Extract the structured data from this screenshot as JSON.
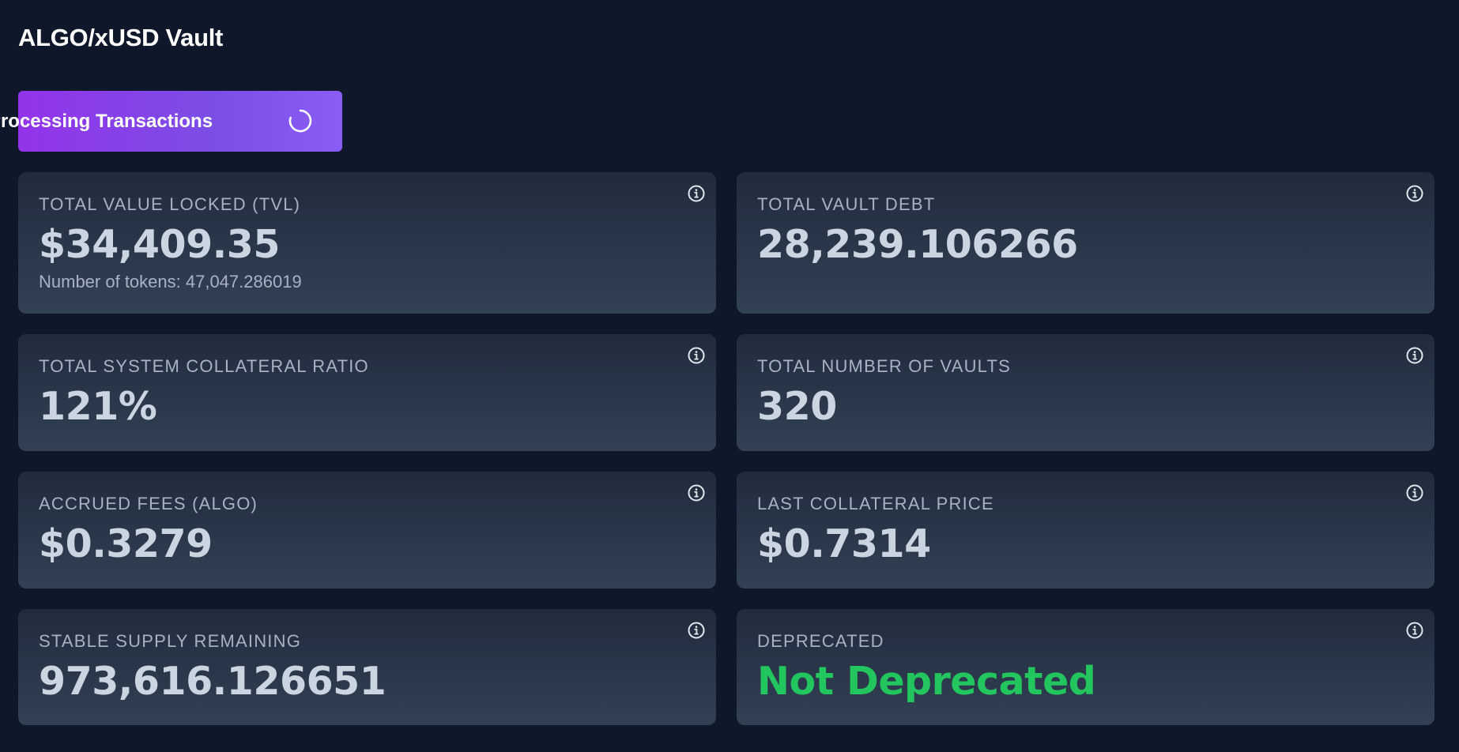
{
  "header": {
    "title": "ALGO/xUSD Vault"
  },
  "status_button": {
    "label": "Processing Transactions",
    "icon": "spinner-icon"
  },
  "colors": {
    "background": "#0f172a",
    "button": "#9333ea",
    "card_top": "#202b3d",
    "card_bottom": "#334155",
    "value_text": "#cbd5e1",
    "label_text": "#a7b3c4",
    "positive": "#22c55e"
  },
  "stats": {
    "tvl": {
      "label": "TOTAL VALUE LOCKED (TVL)",
      "value": "$34,409.35",
      "sub": "Number of tokens: 47,047.286019",
      "icon": "info-icon"
    },
    "vault_debt": {
      "label": "TOTAL VAULT DEBT",
      "value": "28,239.106266",
      "icon": "info-icon"
    },
    "collateral_ratio": {
      "label": "TOTAL SYSTEM COLLATERAL RATIO",
      "value": "121%",
      "icon": "info-icon"
    },
    "num_vaults": {
      "label": "TOTAL NUMBER OF VAULTS",
      "value": "320",
      "icon": "info-icon"
    },
    "accrued_fees": {
      "label": "ACCRUED FEES (ALGO)",
      "value": "$0.3279",
      "icon": "info-icon"
    },
    "collateral_price": {
      "label": "LAST COLLATERAL PRICE",
      "value": "$0.7314",
      "icon": "info-icon"
    },
    "stable_supply": {
      "label": "STABLE SUPPLY REMAINING",
      "value": "973,616.126651",
      "icon": "info-icon"
    },
    "deprecated": {
      "label": "DEPRECATED",
      "value": "Not Deprecated",
      "icon": "info-icon"
    }
  }
}
